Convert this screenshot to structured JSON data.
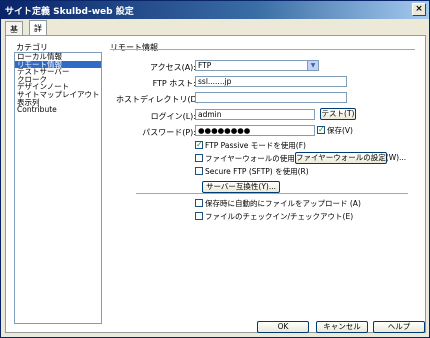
{
  "window": {
    "title": "サイト定義 Skulbd-web 設定",
    "close": "×"
  },
  "tabs": [
    "基本",
    "詳細設定"
  ],
  "category": {
    "label": "カテゴリ",
    "items": [
      "ローカル情報",
      "リモート情報",
      "テストサーバー",
      "クローク",
      "デザインノート",
      "サイトマップレイアウト",
      "表示列",
      "Contribute"
    ],
    "selected_index": 1
  },
  "section": {
    "title": "リモート情報"
  },
  "form": {
    "access_label": "アクセス(A):",
    "access_value": "FTP",
    "ftp_host_label": "FTP ホスト:",
    "ftp_host_value": "ssl.......jp",
    "host_dir_label": "ホストディレクトリ(D):",
    "host_dir_value": "",
    "login_label": "ログイン(L):",
    "login_value": "admin",
    "test_button": "テスト(T)",
    "password_label": "パスワード(P):",
    "password_value": "●●●●●●●●",
    "save_checkbox": "保存(V)",
    "passive_checkbox": "FTP Passive モードを使用(F)",
    "firewall_checkbox": "ファイヤーウォールの使用(U)",
    "firewall_settings_button": "ファイヤーウォールの設定(W)...",
    "sftp_checkbox": "Secure FTP (SFTP) を使用(R)",
    "server_compat_button": "サーバー互換性(Y)...",
    "auto_upload_checkbox": "保存時に自動的にファイルをアップロード (A)",
    "checkin_checkbox": "ファイルのチェックイン/チェックアウト(E)"
  },
  "checkbox_states": {
    "save": true,
    "passive": true,
    "firewall": false,
    "sftp": false,
    "auto_upload": false,
    "checkin": false
  },
  "buttons": {
    "ok": "OK",
    "cancel": "キャンセル",
    "help": "ヘルプ"
  }
}
